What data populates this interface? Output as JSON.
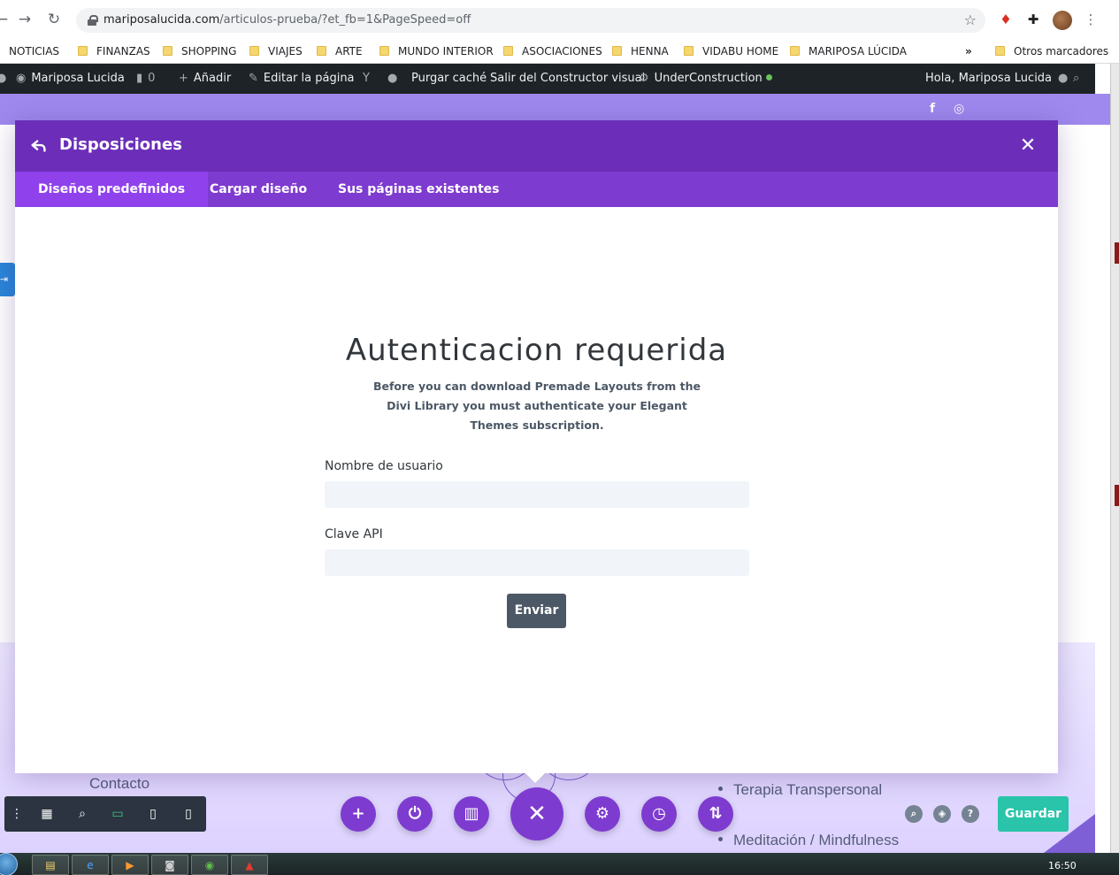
{
  "browser": {
    "url_host": "mariposalucida.com",
    "url_path": "/articulos-prueba/?et_fb=1&PageSpeed=off",
    "bookmarks": [
      "NOTICIAS",
      "FINANZAS",
      "SHOPPING",
      "VIAJES",
      "ARTE",
      "MUNDO INTERIOR",
      "ASOCIACIONES",
      "HENNA",
      "VIDABU HOME",
      "MARIPOSA LÚCIDA"
    ],
    "more_bookmarks": "»",
    "other_bookmarks": "Otros marcadores"
  },
  "wp_admin_bar": {
    "site_name": "Mariposa Lucida",
    "comments_count": "0",
    "add_new": "Añadir",
    "edit_page": "Editar la página",
    "purge_cache": "Purgar caché",
    "exit_builder": "Salir del Constructor visual",
    "under_construction": "UnderConstruction",
    "greeting": "Hola, Mariposa Lucida"
  },
  "modal": {
    "title": "Disposiciones",
    "tabs": [
      {
        "label": "Diseños predefinidos",
        "active": true
      },
      {
        "label": "Cargar diseño",
        "active": false
      },
      {
        "label": "Sus páginas existentes",
        "active": false
      }
    ],
    "auth": {
      "title": "Autenticacion requerida",
      "description": "Before you can download Premade Layouts from the Divi Library you must authenticate your Elegant Themes subscription.",
      "username_label": "Nombre de usuario",
      "username_value": "",
      "api_key_label": "Clave API",
      "api_key_value": "",
      "submit_label": "Enviar"
    }
  },
  "page_footer": {
    "contact": "Contacto",
    "list_items": [
      "Terapia Transpersonal",
      "Meditación / Mindfulness"
    ]
  },
  "divi_toolbar": {
    "save_label": "Guardar"
  },
  "taskbar": {
    "clock": "16:50"
  },
  "colors": {
    "modal_header": "#6c2eb9",
    "modal_tabs": "#7e3bd0",
    "active_tab": "#8f42ec",
    "save_button": "#29c4a9",
    "submit_button": "#4c5866",
    "wp_admin_bar": "#1d2327"
  }
}
